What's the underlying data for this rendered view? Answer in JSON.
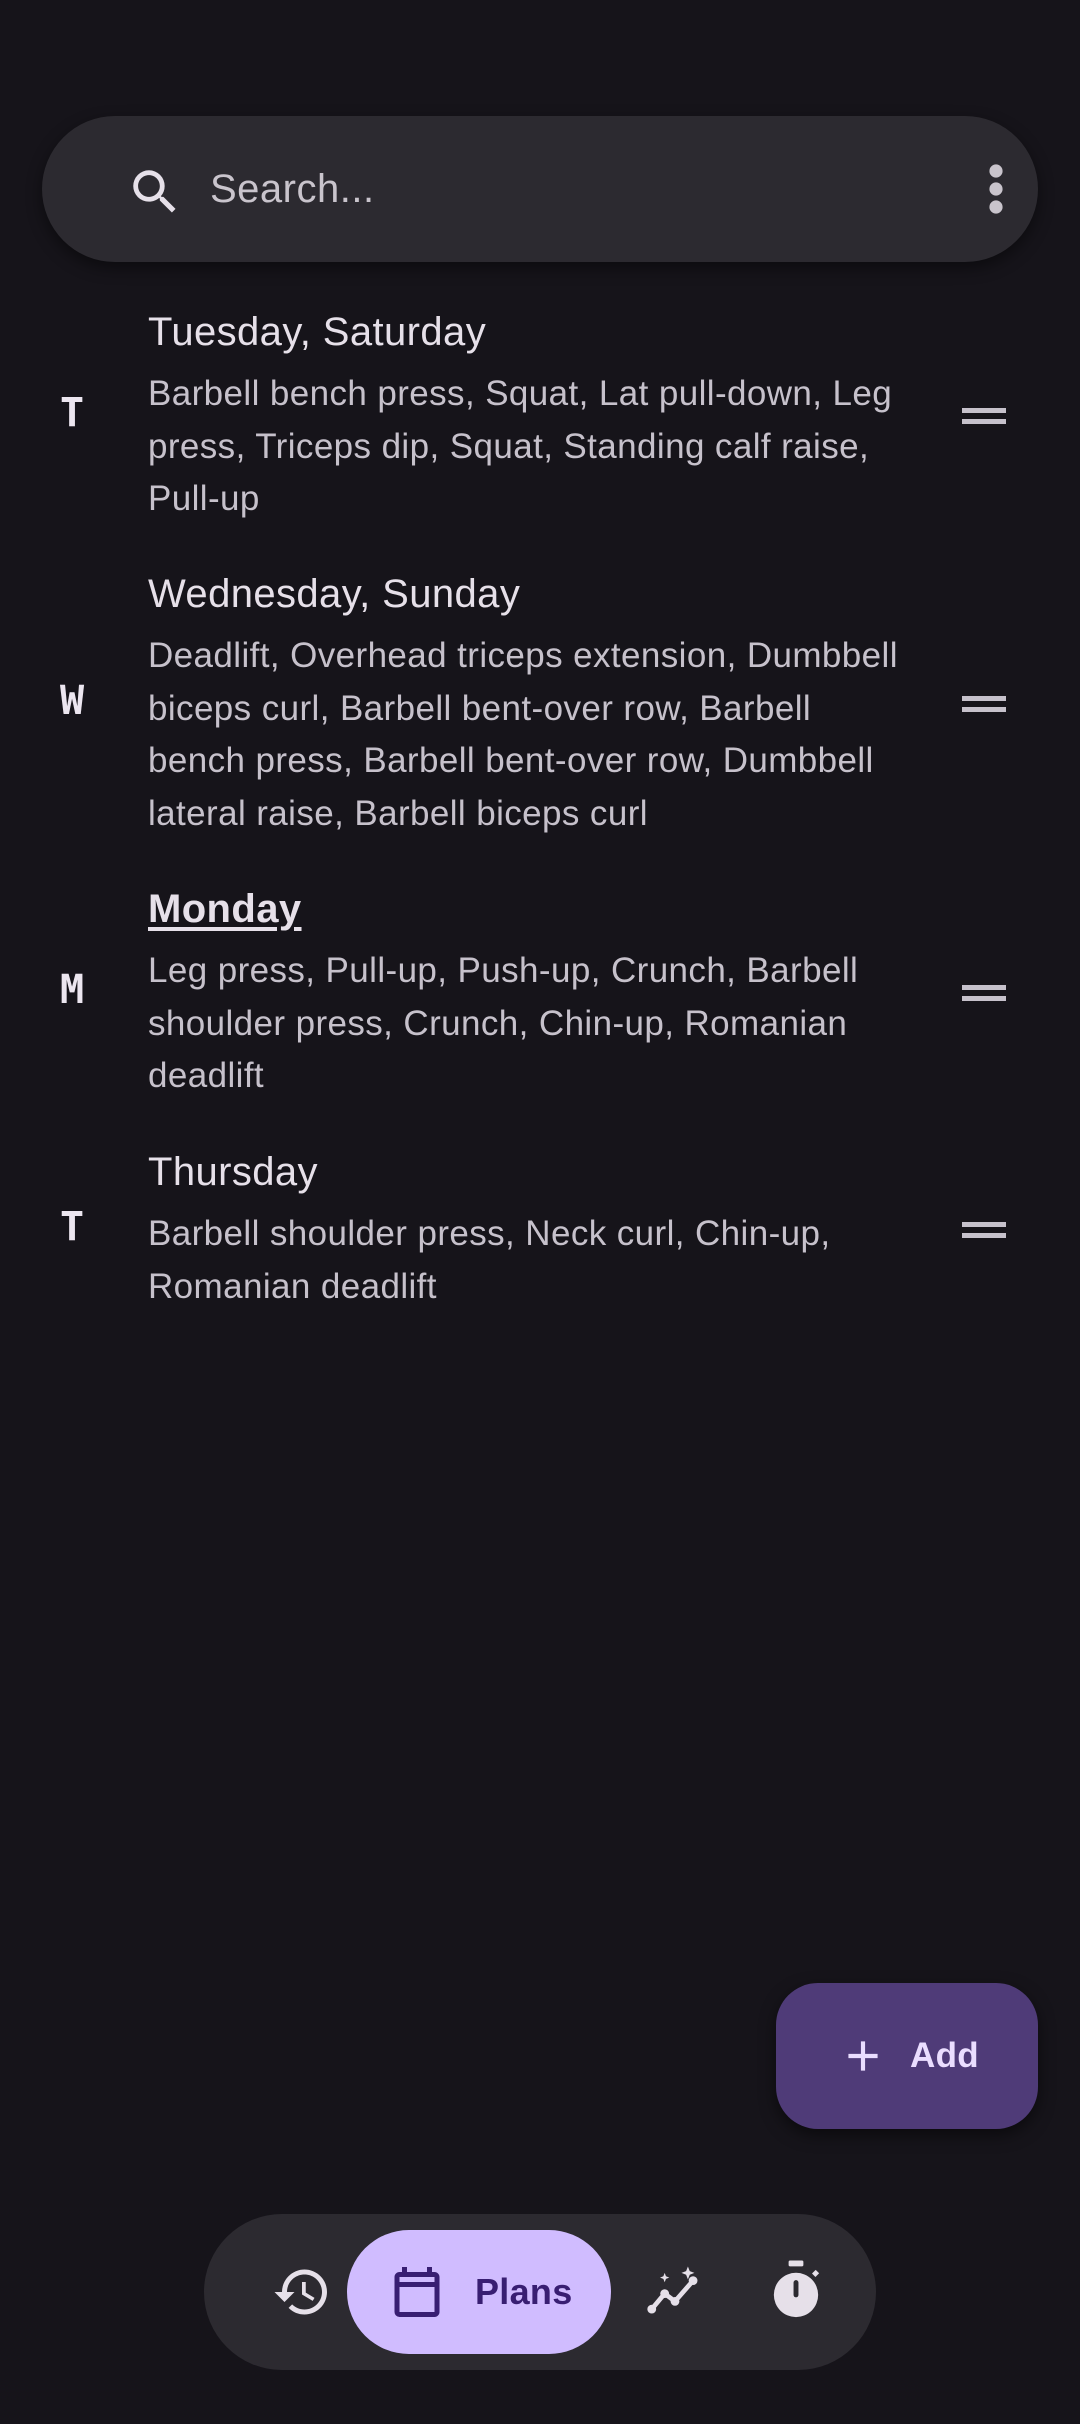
{
  "search": {
    "placeholder": "Search..."
  },
  "plans": [
    {
      "letter": "T",
      "days": "Tuesday, Saturday",
      "active": false,
      "exercises": "Barbell bench press, Squat, Lat pull-down, Leg press, Triceps dip, Squat, Standing calf raise, Pull-up"
    },
    {
      "letter": "W",
      "days": "Wednesday, Sunday",
      "active": false,
      "exercises": "Deadlift, Overhead triceps extension, Dumbbell biceps curl, Barbell bent-over row, Barbell bench press, Barbell bent-over row, Dumbbell lateral raise, Barbell biceps curl"
    },
    {
      "letter": "M",
      "days": "Monday",
      "active": true,
      "exercises": "Leg press, Pull-up, Push-up, Crunch, Barbell shoulder press, Crunch, Chin-up, Romanian deadlift"
    },
    {
      "letter": "T",
      "days": "Thursday",
      "active": false,
      "exercises": "Barbell shoulder press, Neck curl, Chin-up, Romanian deadlift"
    }
  ],
  "fab": {
    "label": "Add",
    "icon": "plus-icon"
  },
  "nav": {
    "items": [
      {
        "id": "history",
        "icon": "history-icon",
        "label": ""
      },
      {
        "id": "plans",
        "icon": "calendar-icon",
        "label": "Plans",
        "selected": true
      },
      {
        "id": "graphs",
        "icon": "graph-icon",
        "label": ""
      },
      {
        "id": "timer",
        "icon": "timer-icon",
        "label": ""
      }
    ]
  },
  "colors": {
    "background": "#16141a",
    "surface": "#2c2a30",
    "primary_container": "#d0bcff",
    "fab": "#4f3b78"
  }
}
